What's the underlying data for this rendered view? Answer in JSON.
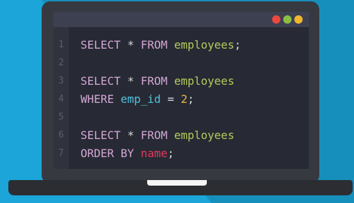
{
  "window_controls": {
    "close_color": "#e9493f",
    "minimize_color": "#8bbf43",
    "maximize_color": "#f0b62f"
  },
  "code_lines": [
    {
      "num": "1",
      "tokens": [
        {
          "t": "SELECT ",
          "c": "kw"
        },
        {
          "t": "* ",
          "c": "op"
        },
        {
          "t": "FROM ",
          "c": "kw"
        },
        {
          "t": "employees",
          "c": "tb"
        },
        {
          "t": ";",
          "c": "op"
        }
      ]
    },
    {
      "num": "2",
      "tokens": []
    },
    {
      "num": "3",
      "tokens": [
        {
          "t": "SELECT ",
          "c": "kw"
        },
        {
          "t": "* ",
          "c": "op"
        },
        {
          "t": "FROM ",
          "c": "kw"
        },
        {
          "t": "employees",
          "c": "tb"
        }
      ]
    },
    {
      "num": "4",
      "tokens": [
        {
          "t": "WHERE ",
          "c": "kw"
        },
        {
          "t": "emp_id ",
          "c": "col"
        },
        {
          "t": "= ",
          "c": "op"
        },
        {
          "t": "2",
          "c": "num"
        },
        {
          "t": ";",
          "c": "op"
        }
      ]
    },
    {
      "num": "5",
      "tokens": []
    },
    {
      "num": "6",
      "tokens": [
        {
          "t": "SELECT ",
          "c": "kw"
        },
        {
          "t": "* ",
          "c": "op"
        },
        {
          "t": "FROM ",
          "c": "kw"
        },
        {
          "t": "employees",
          "c": "tb"
        }
      ]
    },
    {
      "num": "7",
      "tokens": [
        {
          "t": "ORDER BY ",
          "c": "kw"
        },
        {
          "t": "name",
          "c": "nm"
        },
        {
          "t": ";",
          "c": "op"
        }
      ]
    }
  ]
}
